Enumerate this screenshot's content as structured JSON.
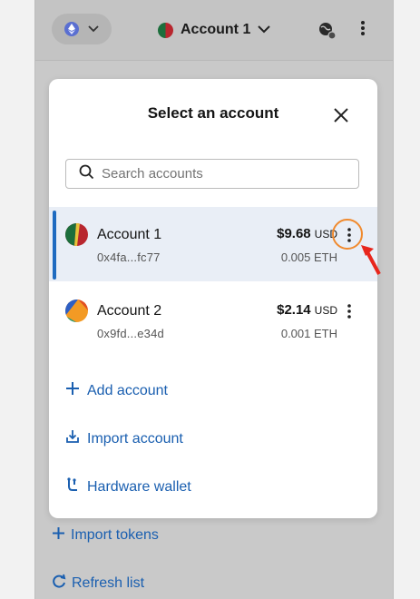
{
  "header": {
    "account_name": "Account 1",
    "network_icon": "ethereum-icon",
    "icons": [
      "chevron-down-icon",
      "globe-icon",
      "kebab-menu-icon"
    ]
  },
  "modal": {
    "title": "Select an account",
    "search_placeholder": "Search accounts",
    "accounts": [
      {
        "name": "Account 1",
        "address": "0x4fa...fc77",
        "usd": "$9.68",
        "usd_label": "USD",
        "eth": "0.005 ETH",
        "selected": true
      },
      {
        "name": "Account 2",
        "address": "0x9fd...e34d",
        "usd": "$2.14",
        "usd_label": "USD",
        "eth": "0.001 ETH",
        "selected": false
      }
    ],
    "actions": {
      "add": "Add account",
      "import": "Import account",
      "hardware": "Hardware wallet"
    }
  },
  "background_links": {
    "import_tokens": "Import tokens",
    "refresh": "Refresh list"
  },
  "colors": {
    "link_blue": "#1a5fb0",
    "selected_bg": "#e9eef6",
    "selected_bar": "#1f6bc0",
    "highlight_orange": "#f08a2e",
    "arrow_red": "#e8261c"
  }
}
